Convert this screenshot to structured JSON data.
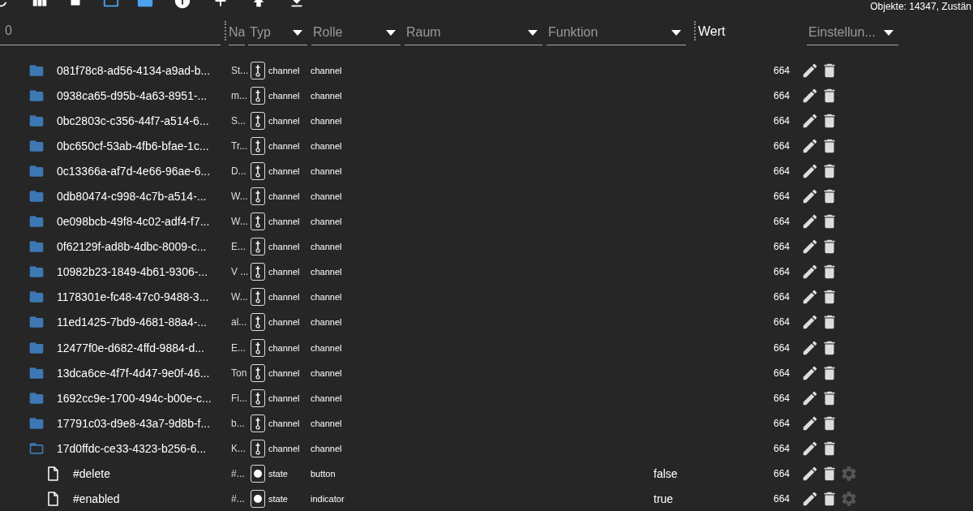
{
  "status_text": "Objekte: 14347, Zustän",
  "filter": {
    "value": "0"
  },
  "header": {
    "name_label": "Na",
    "selects": [
      {
        "label": "Typ"
      },
      {
        "label": "Rolle"
      },
      {
        "label": "Raum"
      },
      {
        "label": "Funktion"
      }
    ],
    "value_label": "Wert",
    "settings_select": {
      "label": "Einstellun..."
    }
  },
  "rows": [
    {
      "kind": "channel",
      "expanded": false,
      "id": "081f78c8-ad56-4134-a9ad-b...",
      "name": "St...",
      "type": "channel",
      "role": "channel",
      "acl": "664"
    },
    {
      "kind": "channel",
      "expanded": false,
      "id": "0938ca65-d95b-4a63-8951-...",
      "name": "m...",
      "type": "channel",
      "role": "channel",
      "acl": "664"
    },
    {
      "kind": "channel",
      "expanded": false,
      "id": "0bc2803c-c356-44f7-a514-6...",
      "name": "S...",
      "type": "channel",
      "role": "channel",
      "acl": "664"
    },
    {
      "kind": "channel",
      "expanded": false,
      "id": "0bc650cf-53ab-4fb6-bfae-1c...",
      "name": "Tr...",
      "type": "channel",
      "role": "channel",
      "acl": "664"
    },
    {
      "kind": "channel",
      "expanded": false,
      "id": "0c13366a-af7d-4e66-96ae-6...",
      "name": "D...",
      "type": "channel",
      "role": "channel",
      "acl": "664"
    },
    {
      "kind": "channel",
      "expanded": false,
      "id": "0db80474-c998-4c7b-a514-...",
      "name": "W...",
      "type": "channel",
      "role": "channel",
      "acl": "664"
    },
    {
      "kind": "channel",
      "expanded": false,
      "id": "0e098bcb-49f8-4c02-adf4-f7...",
      "name": "W...",
      "type": "channel",
      "role": "channel",
      "acl": "664"
    },
    {
      "kind": "channel",
      "expanded": false,
      "id": "0f62129f-ad8b-4dbc-8009-c...",
      "name": "E...",
      "type": "channel",
      "role": "channel",
      "acl": "664"
    },
    {
      "kind": "channel",
      "expanded": false,
      "id": "10982b23-1849-4b61-9306-...",
      "name": "V ...",
      "type": "channel",
      "role": "channel",
      "acl": "664"
    },
    {
      "kind": "channel",
      "expanded": false,
      "id": "1178301e-fc48-47c0-9488-3...",
      "name": "W...",
      "type": "channel",
      "role": "channel",
      "acl": "664"
    },
    {
      "kind": "channel",
      "expanded": false,
      "id": "11ed1425-7bd9-4681-88a4-...",
      "name": "al...",
      "type": "channel",
      "role": "channel",
      "acl": "664"
    },
    {
      "kind": "channel",
      "expanded": false,
      "id": "12477f0e-d682-4ffd-9884-d...",
      "name": "E...",
      "type": "channel",
      "role": "channel",
      "acl": "664"
    },
    {
      "kind": "channel",
      "expanded": false,
      "id": "13dca6ce-4f7f-4d47-9e0f-46...",
      "name": "Ton",
      "type": "channel",
      "role": "channel",
      "acl": "664"
    },
    {
      "kind": "channel",
      "expanded": false,
      "id": "1692cc9e-1700-494c-b00e-c...",
      "name": "Fi...",
      "type": "channel",
      "role": "channel",
      "acl": "664"
    },
    {
      "kind": "channel",
      "expanded": false,
      "id": "17791c03-d9e8-43a7-9d8b-f...",
      "name": "b...",
      "type": "channel",
      "role": "channel",
      "acl": "664"
    },
    {
      "kind": "channel",
      "expanded": true,
      "id": "17d0ffdc-ce33-4323-b256-6...",
      "name": "K...",
      "type": "channel",
      "role": "channel",
      "acl": "664",
      "children": [
        {
          "kind": "state",
          "id": "#delete",
          "name": "#...",
          "type": "state",
          "role": "button",
          "value": "false",
          "acl": "664"
        },
        {
          "kind": "state",
          "id": "#enabled",
          "name": "#...",
          "type": "state",
          "role": "indicator",
          "value": "true",
          "acl": "664"
        }
      ]
    }
  ]
}
